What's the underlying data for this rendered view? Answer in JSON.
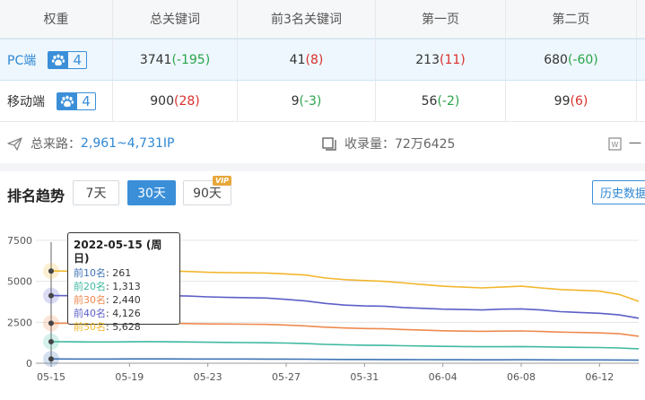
{
  "table": {
    "headers": [
      "权重",
      "总关键词",
      "前3名关键词",
      "第一页",
      "第二页"
    ],
    "rows": [
      {
        "platform": "PC端",
        "weight": "4",
        "total": "3741",
        "total_delta": "(-195)",
        "top3": "41",
        "top3_delta": "(8)",
        "page1": "213",
        "page1_delta": "(11)",
        "page2": "680",
        "page2_delta": "(-60)"
      },
      {
        "platform": "移动端",
        "weight": "4",
        "total": "900",
        "total_delta": "(28)",
        "top3": "9",
        "top3_delta": "(-3)",
        "page1": "56",
        "page1_delta": "(-2)",
        "page2": "99",
        "page2_delta": "(6)"
      }
    ]
  },
  "info": {
    "traffic_label": "总来路：",
    "traffic_value": "2,961~4,731IP",
    "index_label": "收录量：",
    "index_value": "72万6425",
    "third_label": "一"
  },
  "trend": {
    "title": "排名趋势",
    "ranges": [
      "7天",
      "30天",
      "90天"
    ],
    "active_range": "30天",
    "vip": "VIP",
    "history": "历史数据"
  },
  "colors": {
    "accent": "#3b8fd9",
    "negative": "#2aa34a",
    "positive": "#d9302c"
  },
  "tooltip": {
    "date": "2022-05-15 (周日)",
    "items": [
      {
        "label": "前10名",
        "value": "261",
        "color": "#3f74b5"
      },
      {
        "label": "前20名",
        "value": "1,313",
        "color": "#3fb9a0"
      },
      {
        "label": "前30名",
        "value": "2,440",
        "color": "#ee8a4f"
      },
      {
        "label": "前40名",
        "value": "4,126",
        "color": "#5c5fc7"
      },
      {
        "label": "前50名",
        "value": "5,628",
        "color": "#f2b62e"
      }
    ]
  },
  "chart_data": {
    "type": "line",
    "ylim": [
      0,
      7500
    ],
    "yticks": [
      "0",
      "2500",
      "5000",
      "7500"
    ],
    "xticks": [
      "05-15",
      "05-19",
      "05-23",
      "05-27",
      "05-31",
      "06-04",
      "06-08",
      "06-12"
    ],
    "x": [
      "05-15",
      "05-16",
      "05-17",
      "05-18",
      "05-19",
      "05-20",
      "05-21",
      "05-22",
      "05-23",
      "05-24",
      "05-25",
      "05-26",
      "05-27",
      "05-28",
      "05-29",
      "05-30",
      "05-31",
      "06-01",
      "06-02",
      "06-03",
      "06-04",
      "06-05",
      "06-06",
      "06-07",
      "06-08",
      "06-09",
      "06-10",
      "06-11",
      "06-12",
      "06-13",
      "06-14"
    ],
    "series": [
      {
        "name": "前50名",
        "color": "#f2b62e",
        "values": [
          5628,
          5620,
          5610,
          5600,
          5640,
          5650,
          5630,
          5600,
          5550,
          5530,
          5520,
          5510,
          5450,
          5380,
          5200,
          5100,
          5050,
          5000,
          4900,
          4800,
          4700,
          4650,
          4600,
          4650,
          4700,
          4600,
          4500,
          4450,
          4400,
          4200,
          3780
        ]
      },
      {
        "name": "前40名",
        "color": "#5c5fc7",
        "values": [
          4126,
          4120,
          4110,
          4100,
          4130,
          4140,
          4120,
          4100,
          4050,
          4020,
          4000,
          3980,
          3900,
          3800,
          3650,
          3550,
          3500,
          3480,
          3400,
          3350,
          3300,
          3280,
          3250,
          3300,
          3320,
          3250,
          3150,
          3100,
          3050,
          2950,
          2750
        ]
      },
      {
        "name": "前30名",
        "color": "#ee8a4f",
        "values": [
          2440,
          2440,
          2430,
          2420,
          2450,
          2450,
          2440,
          2420,
          2400,
          2390,
          2380,
          2370,
          2330,
          2280,
          2200,
          2150,
          2120,
          2100,
          2060,
          2020,
          1980,
          1960,
          1950,
          1960,
          1970,
          1940,
          1900,
          1880,
          1850,
          1800,
          1650
        ]
      },
      {
        "name": "前20名",
        "color": "#3fb9a0",
        "values": [
          1313,
          1310,
          1300,
          1300,
          1310,
          1320,
          1310,
          1300,
          1280,
          1270,
          1260,
          1250,
          1230,
          1200,
          1150,
          1120,
          1100,
          1090,
          1070,
          1050,
          1030,
          1020,
          1010,
          1010,
          1020,
          1000,
          980,
          970,
          960,
          930,
          880
        ]
      },
      {
        "name": "前10名",
        "color": "#3f74b5",
        "values": [
          261,
          260,
          260,
          258,
          262,
          264,
          262,
          260,
          258,
          256,
          255,
          254,
          250,
          245,
          238,
          232,
          228,
          226,
          222,
          218,
          214,
          212,
          210,
          210,
          212,
          208,
          204,
          202,
          200,
          196,
          186
        ]
      }
    ]
  }
}
